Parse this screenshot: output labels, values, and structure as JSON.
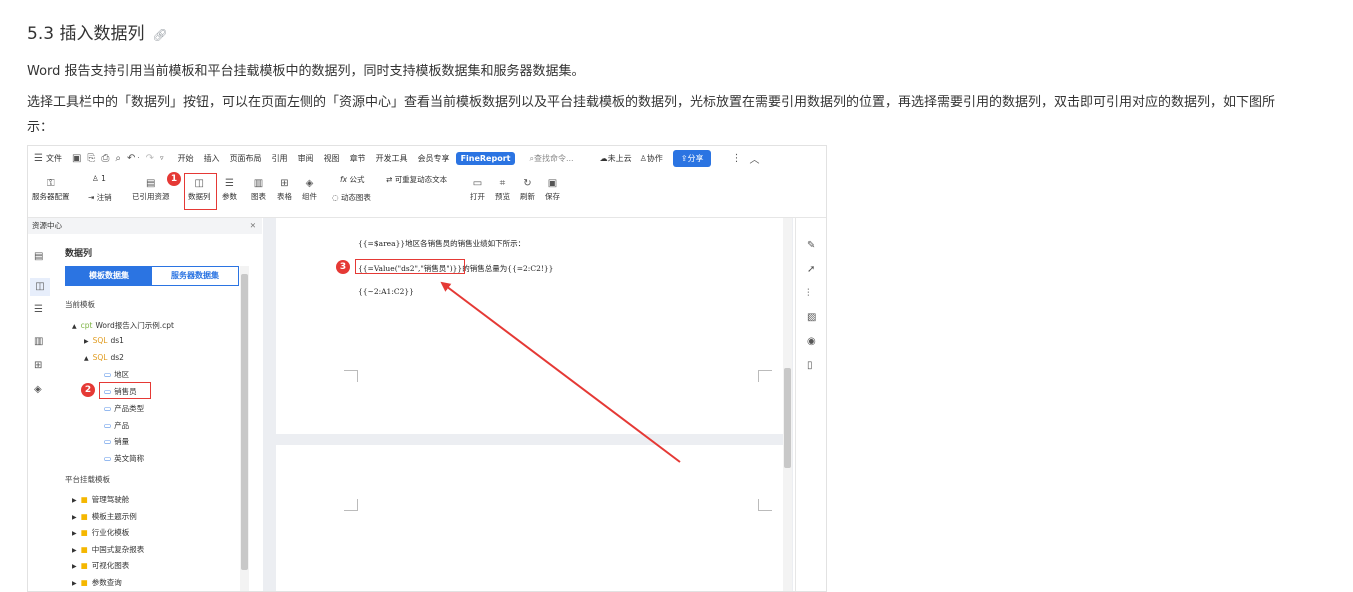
{
  "section": {
    "title": "5.3 插入数据列",
    "anchor_icon": "link-icon",
    "paragraph1": "Word 报告支持引用当前模板和平台挂载模板中的数据列，同时支持模板数据集和服务器数据集。",
    "paragraph2": "选择工具栏中的「数据列」按钮，可以在页面左侧的「资源中心」查看当前模板数据列以及平台挂载模板的数据列，光标放置在需要引用数据列的位置，再选择需要引用的数据列，双击即可引用对应的数据列，如下图所示："
  },
  "screenshot": {
    "menubar": {
      "file": "文件",
      "tabs": [
        "开始",
        "插入",
        "页面布局",
        "引用",
        "审阅",
        "视图",
        "章节",
        "开发工具",
        "会员专享"
      ],
      "brand": "FineReport",
      "search_placeholder": "查找命令...",
      "cloud": "未上云",
      "collab": "协作",
      "share": "分享"
    },
    "ribbon": {
      "server_config": "服务器配置",
      "user_count": "1",
      "logout": "注销",
      "referenced": "已引用资源",
      "data_column": "数据列",
      "param": "参数",
      "chart": "图表",
      "table": "表格",
      "widget": "组件",
      "formula": "公式",
      "repeatable_text": "可重复动态文本",
      "dynamic_chart": "动态图表",
      "open": "打开",
      "preview": "预览",
      "refresh": "刷新",
      "save": "保存"
    },
    "resource_center": {
      "header": "资源中心",
      "title": "数据列",
      "tab_template": "模板数据集",
      "tab_server": "服务器数据集",
      "current_template_label": "当前模板",
      "template_file": "Word报告入门示例.cpt",
      "datasets": [
        "ds1",
        "ds2"
      ],
      "columns": [
        "地区",
        "销售员",
        "产品类型",
        "产品",
        "销量",
        "英文简称"
      ],
      "platform_label": "平台挂载模板",
      "folders": [
        "管理驾驶舱",
        "模板主题示例",
        "行业化模板",
        "中国式复杂报表",
        "可视化图表",
        "参数查询"
      ]
    },
    "document": {
      "line1": "{{=$area}}地区各销售员的销售业绩如下所示：",
      "line2_field": "{{=Value(\"ds2\",\"销售员\")}}",
      "line2_rest": "的销售总量为{{=2:C2!}}",
      "line3": "{{~2:A1:C2}}"
    },
    "steps": [
      "1",
      "2",
      "3"
    ]
  }
}
